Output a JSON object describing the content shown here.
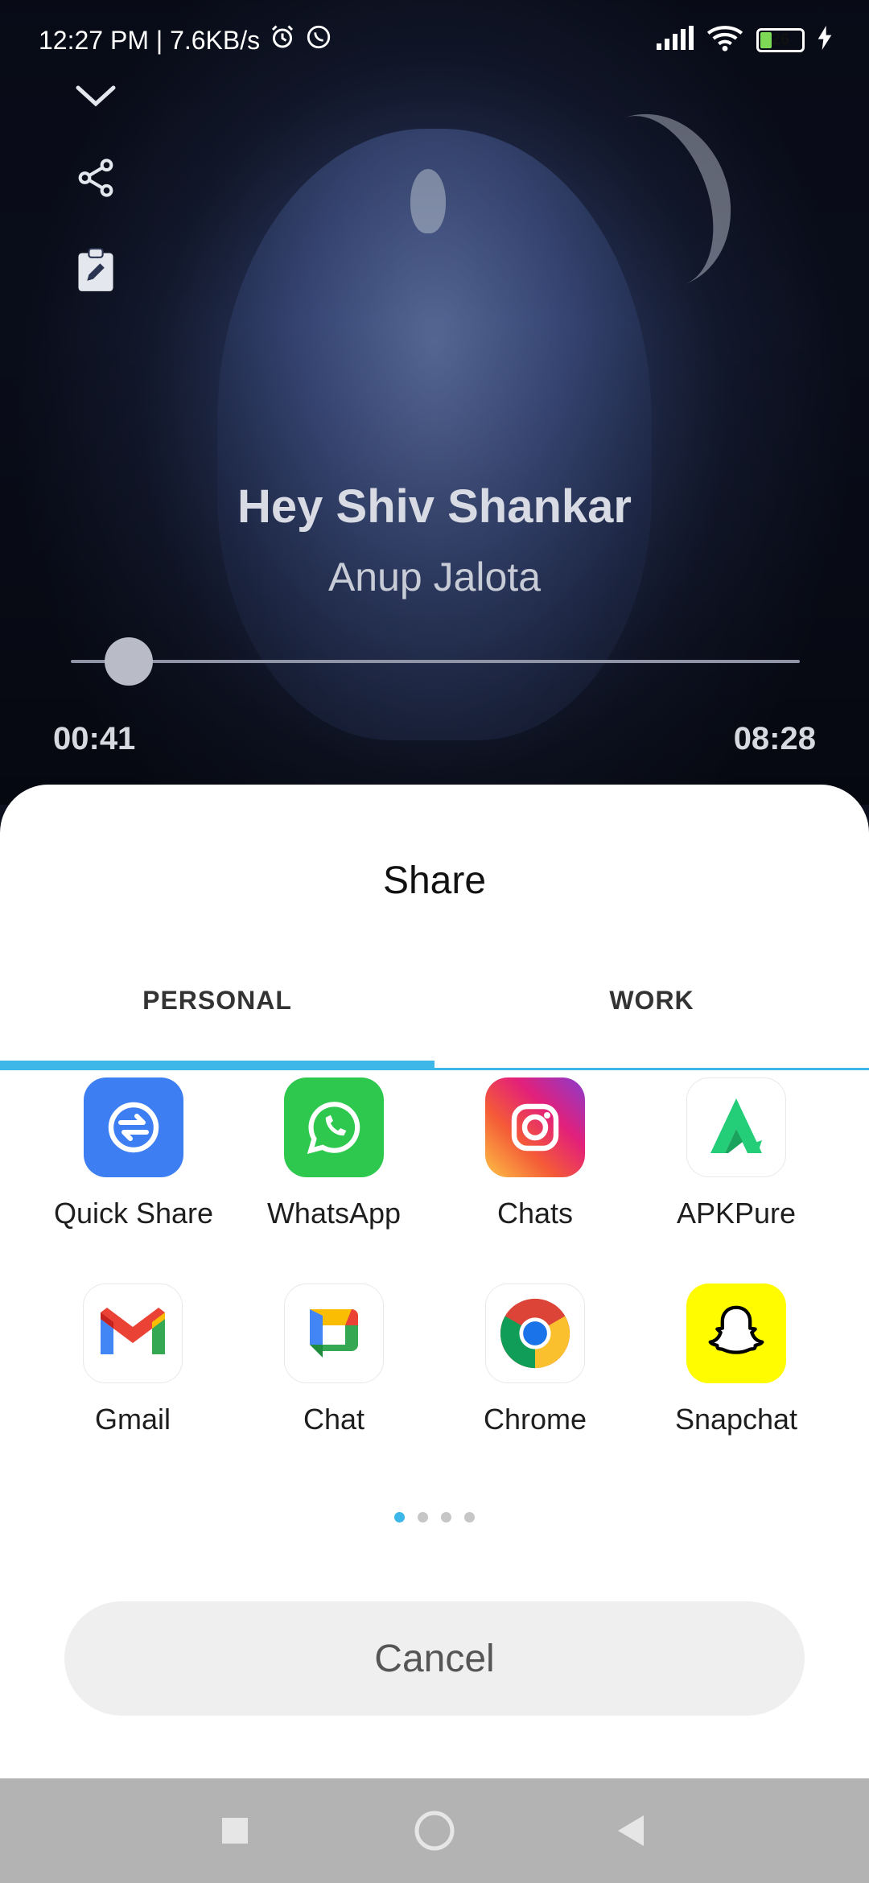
{
  "status_bar": {
    "time_speed": "12:27 PM | 7.6KB/s",
    "battery_level": "26"
  },
  "player": {
    "title": "Hey Shiv Shankar",
    "artist": "Anup Jalota",
    "elapsed": "00:41",
    "duration": "08:28",
    "progress_fraction": 0.08
  },
  "share_sheet": {
    "title": "Share",
    "tabs": [
      {
        "label": "PERSONAL",
        "selected": true
      },
      {
        "label": "WORK",
        "selected": false
      }
    ],
    "apps": [
      {
        "label": "Quick Share",
        "icon": "quick-share-icon"
      },
      {
        "label": "WhatsApp",
        "icon": "whatsapp-icon"
      },
      {
        "label": "Chats",
        "icon": "instagram-icon"
      },
      {
        "label": "APKPure",
        "icon": "apkpure-icon"
      },
      {
        "label": "Gmail",
        "icon": "gmail-icon"
      },
      {
        "label": "Chat",
        "icon": "google-chat-icon"
      },
      {
        "label": "Chrome",
        "icon": "chrome-icon"
      },
      {
        "label": "Snapchat",
        "icon": "snapchat-icon"
      }
    ],
    "page_count": 4,
    "active_page": 1,
    "cancel_label": "Cancel"
  },
  "colors": {
    "accent": "#3db6e8",
    "sheet_bg": "#ffffff",
    "nav_bg": "#b3b3b3"
  }
}
